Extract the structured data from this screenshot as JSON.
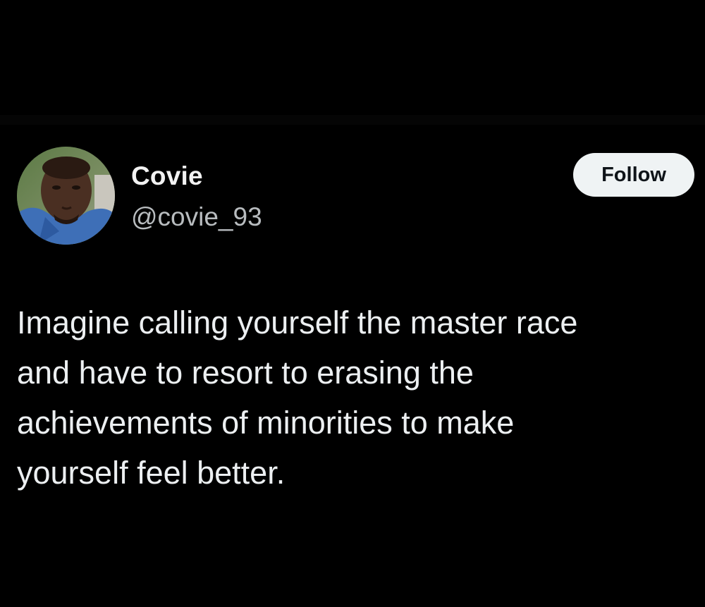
{
  "tweet": {
    "author": {
      "display_name": "Covie",
      "handle": "@covie_93",
      "avatar_icon": "user-avatar-photo"
    },
    "follow_label": "Follow",
    "text": "Imagine calling yourself the master race\nand have to resort to erasing the\nachievements of minorities to make\nyourself feel better."
  },
  "colors": {
    "background": "#000000",
    "text_primary": "#e7e9ea",
    "text_secondary": "#b8bcbf",
    "follow_bg": "#eff3f4",
    "follow_text": "#0f1419"
  }
}
